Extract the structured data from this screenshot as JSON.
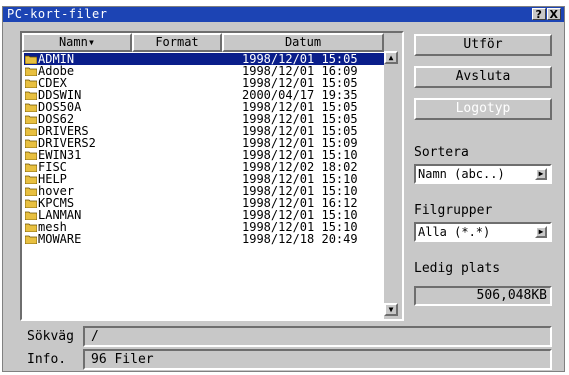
{
  "window": {
    "title": "PC-kort-filer",
    "help_button": "?",
    "close_button": "X"
  },
  "columns": {
    "name": "Namn▾",
    "format": "Format",
    "date": "Datum"
  },
  "files": [
    {
      "name": "ADMIN",
      "date": "1998/12/01 15:05",
      "selected": true
    },
    {
      "name": "Adobe",
      "date": "1998/12/01 16:09"
    },
    {
      "name": "CDEX",
      "date": "1998/12/01 15:05"
    },
    {
      "name": "DDSWIN",
      "date": "2000/04/17 19:35"
    },
    {
      "name": "DOS50A",
      "date": "1998/12/01 15:05"
    },
    {
      "name": "DOS62",
      "date": "1998/12/01 15:05"
    },
    {
      "name": "DRIVERS",
      "date": "1998/12/01 15:05"
    },
    {
      "name": "DRIVERS2",
      "date": "1998/12/01 15:09"
    },
    {
      "name": "EWIN31",
      "date": "1998/12/01 15:10"
    },
    {
      "name": "FISC",
      "date": "1998/12/02 18:02"
    },
    {
      "name": "HELP",
      "date": "1998/12/01 15:10"
    },
    {
      "name": "hover",
      "date": "1998/12/01 15:10"
    },
    {
      "name": "KPCMS",
      "date": "1998/12/01 16:12"
    },
    {
      "name": "LANMAN",
      "date": "1998/12/01 15:10"
    },
    {
      "name": "mesh",
      "date": "1998/12/01 15:10"
    },
    {
      "name": "MOWARE",
      "date": "1998/12/18 20:49"
    }
  ],
  "buttons": {
    "execute": "Utför",
    "exit": "Avsluta",
    "logo": "Logotyp"
  },
  "sort": {
    "label": "Sortera",
    "value": "Namn (abc..)"
  },
  "filegroups": {
    "label": "Filgrupper",
    "value": "Alla (*.*)"
  },
  "free_space": {
    "label": "Ledig plats",
    "value": "506,048KB"
  },
  "path": {
    "label": "Sökväg",
    "value": "/"
  },
  "info": {
    "label": "Info.",
    "value": "96 Filer"
  },
  "icons": {
    "folder": "folder-icon",
    "scroll_up": "scroll-up-arrow-icon",
    "scroll_down": "scroll-down-arrow-icon",
    "dropdown": "dropdown-arrow-icon"
  },
  "colors": {
    "titlebar": "#1c44b4",
    "selection": "#0a1e8a",
    "folder": "#e8c040",
    "window": "#c8c8c8"
  }
}
